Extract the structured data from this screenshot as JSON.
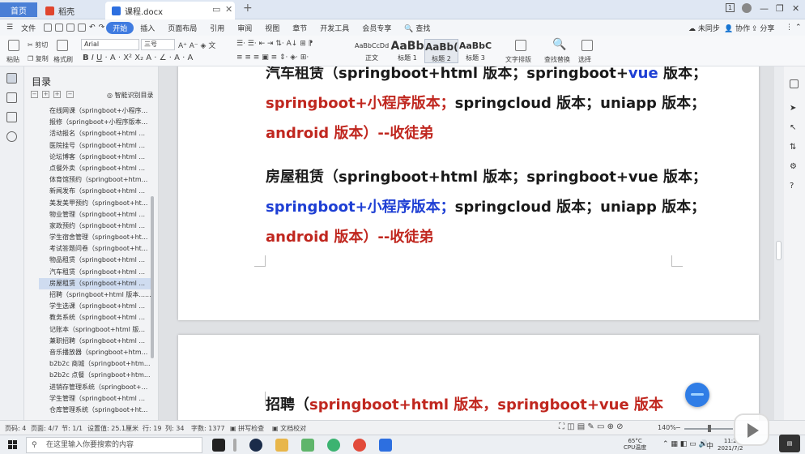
{
  "tabs": {
    "home": "首页",
    "daoke": "稻壳",
    "doc": "课程.docx",
    "new_tab": "+"
  },
  "window": {
    "page_indicator": "1"
  },
  "menu": {
    "file": "文件",
    "items": [
      "开始",
      "插入",
      "页面布局",
      "引用",
      "审阅",
      "视图",
      "章节",
      "开发工具",
      "会员专享"
    ],
    "search": "查找",
    "unsync": "未同步",
    "collab": "协作",
    "share": "分享"
  },
  "ribbon": {
    "paste": "粘贴",
    "cut": "剪切",
    "copy": "复制",
    "format_painter": "格式刷",
    "font_name": "Arial",
    "font_size": "三号",
    "styles": [
      {
        "preview": "AaBbCcDd",
        "label": "正文"
      },
      {
        "preview": "AaBb",
        "label": "标题 1"
      },
      {
        "preview": "AaBb(",
        "label": "标题 2"
      },
      {
        "preview": "AaBbC",
        "label": "标题 3"
      }
    ],
    "text_layout": "文字排版",
    "find_replace": "查找替换",
    "select": "选择"
  },
  "outline": {
    "title": "目录",
    "smart_toc": "智能识别目录",
    "items": [
      "在线网课（springboot+小程序...",
      "报修（springboot+小程序版本...",
      "活动报名（springboot+html ...",
      "医院挂号（springboot+html ...",
      "论坛博客（springboot+html ...",
      "点餐外卖（springboot+html ...",
      "体育馆预约（springboot+htm...",
      "新闻发布（springboot+html ...",
      "美发美甲预约（springboot+ht...",
      "物业管理（springboot+html ...",
      "家政预约（springboot+html ...",
      "学生宿舍管理（springboot+ht...",
      "考试答题问卷（springboot+ht...",
      "物品租赁（springboot+html ...",
      "汽车租赁（springboot+html ...",
      "房屋租赁（springboot+html ...",
      "招聘（springboot+html 版本......",
      "学生选课（springboot+html ...",
      "教务系统（springboot+html ...",
      "记账本（springboot+html 版...",
      "兼职招聘（springboot+html ...",
      "音乐播放器（springboot+htm...",
      "b2b2c 商城（springboot+htm...",
      "b2b2c 点餐（springboot+htm...",
      "进销存管理系统（springboot+...",
      "学生管理（springboot+html ...",
      "仓库管理系统（springboot+ht..."
    ],
    "selected_index": 15
  },
  "document": {
    "block1": {
      "line1": "汽车租赁（springboot+html 版本；springboot+",
      "line1_blue": "vue",
      "line1_end": " 版本；",
      "line2_red": "springboot+小程序版本；",
      "line2_black": "springcloud 版本；uniapp 版本；",
      "line3_red": "android 版本）--收徒弟"
    },
    "block2": {
      "line1": "房屋租赁（springboot+html 版本；springboot+vue 版本；",
      "line2_blue": "springboot+小程序版本；",
      "line2_black": "springcloud 版本；uniapp 版本；",
      "line3_red": "android 版本）--收徒弟"
    },
    "block3": {
      "line1_black": "招聘（",
      "line1_red": "springboot+html 版本，springboot+vue 版本"
    }
  },
  "statusbar": {
    "page_no": "页码: 4",
    "page": "页面: 4/7",
    "section": "节: 1/1",
    "position": "设置值: 25.1厘米",
    "row": "行: 19",
    "col": "列: 34",
    "words": "字数: 1377",
    "spellcheck": "拼写检查",
    "proofread": "文档校对",
    "zoom": "140%"
  },
  "taskbar": {
    "search_placeholder": "在这里输入你要搜索的内容",
    "temp": "65°C",
    "temp_label": "CPU温度",
    "ime": "中",
    "time": "11:2",
    "date": "2021/7/2"
  },
  "colors": {
    "accent": "#3f7be0",
    "red_text": "#c0271f",
    "blue_text": "#1e3fd4"
  }
}
